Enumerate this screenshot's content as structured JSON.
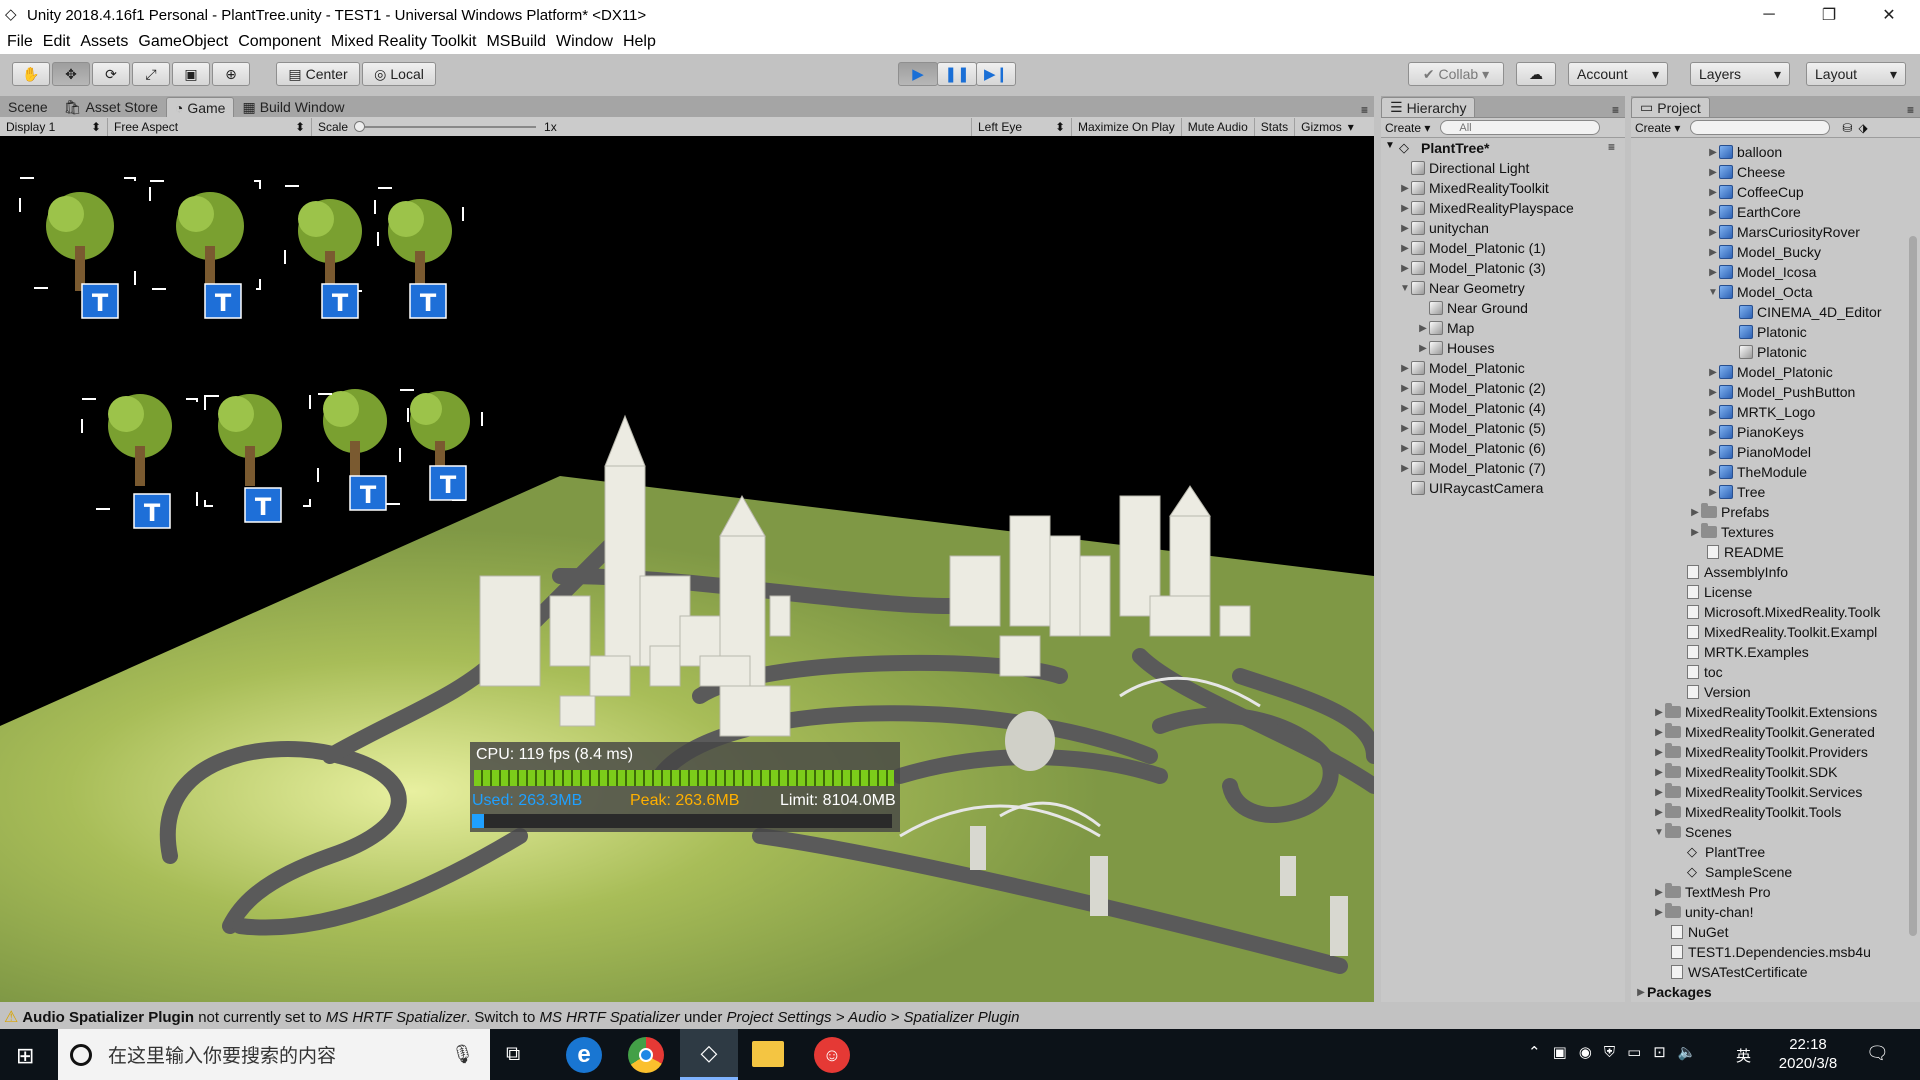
{
  "window": {
    "title": "Unity 2018.4.16f1 Personal - PlantTree.unity - TEST1 - Universal Windows Platform* <DX11>"
  },
  "menu": [
    "File",
    "Edit",
    "Assets",
    "GameObject",
    "Component",
    "Mixed Reality Toolkit",
    "MSBuild",
    "Window",
    "Help"
  ],
  "toolbar": {
    "center_label": "Center",
    "local_label": "Local",
    "collab_label": "Collab",
    "account_label": "Account",
    "layers_label": "Layers",
    "layout_label": "Layout"
  },
  "tabs": {
    "scene": "Scene",
    "asset_store": "Asset Store",
    "game": "Game",
    "build_window": "Build Window"
  },
  "game_bar": {
    "display": "Display 1",
    "aspect": "Free Aspect",
    "scale_label": "Scale",
    "scale_value": "1x",
    "eye": "Left Eye",
    "maximize": "Maximize On Play",
    "mute": "Mute Audio",
    "stats": "Stats",
    "gizmos": "Gizmos"
  },
  "stats_overlay": {
    "cpu": "CPU: 119 fps (8.4 ms)",
    "used": "Used: 263.3MB",
    "peak": "Peak: 263.6MB",
    "limit": "Limit: 8104.0MB"
  },
  "hierarchy": {
    "tab": "Hierarchy",
    "create": "Create",
    "search_placeholder": "All",
    "scene": "PlantTree*",
    "items": [
      "Directional Light",
      "MixedRealityToolkit",
      "MixedRealityPlayspace",
      "unitychan",
      "Model_Platonic (1)",
      "Model_Platonic (3)",
      "Near Geometry",
      "Near Ground",
      "Map",
      "Houses",
      "Model_Platonic",
      "Model_Platonic (2)",
      "Model_Platonic (4)",
      "Model_Platonic (5)",
      "Model_Platonic (6)",
      "Model_Platonic (7)",
      "UIRaycastCamera"
    ]
  },
  "project": {
    "tab": "Project",
    "create": "Create",
    "items": [
      "balloon",
      "Cheese",
      "CoffeeCup",
      "EarthCore",
      "MarsCuriosityRover",
      "Model_Bucky",
      "Model_Icosa",
      "Model_Octa",
      "CINEMA_4D_Editor",
      "Platonic",
      "Platonic",
      "Model_Platonic",
      "Model_PushButton",
      "MRTK_Logo",
      "PianoKeys",
      "PianoModel",
      "TheModule",
      "Tree",
      "Prefabs",
      "Textures",
      "README",
      "AssemblyInfo",
      "License",
      "Microsoft.MixedReality.Toolk",
      "MixedReality.Toolkit.Exampl",
      "MRTK.Examples",
      "toc",
      "Version",
      "MixedRealityToolkit.Extensions",
      "MixedRealityToolkit.Generated",
      "MixedRealityToolkit.Providers",
      "MixedRealityToolkit.SDK",
      "MixedRealityToolkit.Services",
      "MixedRealityToolkit.Tools",
      "Scenes",
      "PlantTree",
      "SampleScene",
      "TextMesh Pro",
      "unity-chan!",
      "NuGet",
      "TEST1.Dependencies.msb4u",
      "WSATestCertificate",
      "Packages"
    ]
  },
  "status": {
    "bold": "Audio Spatializer Plugin",
    "rest": " not currently set to ",
    "i1": "MS HRTF Spatializer",
    "mid": ". Switch to ",
    "i2": "MS HRTF Spatializer",
    "under": " under ",
    "i3": "Project Settings > Audio > Spatializer Plugin"
  },
  "taskbar": {
    "search_placeholder": "在这里输入你要搜索的内容",
    "time": "22:18",
    "date": "2020/3/8",
    "ime": "英"
  },
  "colors": {
    "used": "#1fa0ff",
    "peak": "#ffb000",
    "bar": "#7ccc1a",
    "ground": "#7f9845"
  }
}
